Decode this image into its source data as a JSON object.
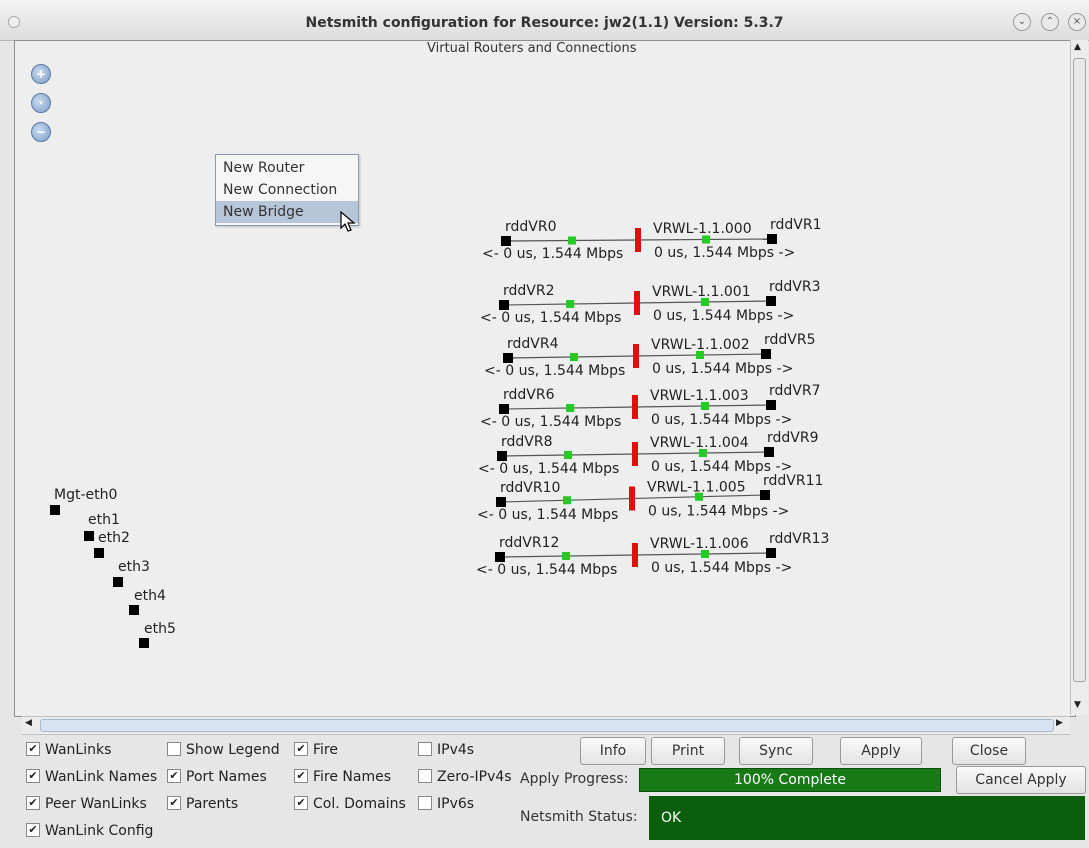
{
  "window": {
    "title": "Netsmith configuration for Resource:  jw2(1.1)  Version: 5.3.7"
  },
  "panel": {
    "legend": "Virtual Routers and Connections"
  },
  "context_menu": {
    "items": [
      "New Router",
      "New Connection",
      "New Bridge"
    ],
    "selected": "New Bridge"
  },
  "ports": {
    "mgt": "Mgt-eth0",
    "eth": [
      "eth1",
      "eth2",
      "eth3",
      "eth4",
      "eth5"
    ]
  },
  "wanlinks": [
    {
      "left": "rddVR0",
      "right": "rddVR1",
      "name": "VRWL-1.1.000",
      "left_stats": "<- 0 us, 1.544 Mbps",
      "right_stats": "0 us, 1.544 Mbps ->"
    },
    {
      "left": "rddVR2",
      "right": "rddVR3",
      "name": "VRWL-1.1.001",
      "left_stats": "<- 0 us, 1.544 Mbps",
      "right_stats": "0 us, 1.544 Mbps ->"
    },
    {
      "left": "rddVR4",
      "right": "rddVR5",
      "name": "VRWL-1.1.002",
      "left_stats": "<- 0 us, 1.544 Mbps",
      "right_stats": "0 us, 1.544 Mbps ->"
    },
    {
      "left": "rddVR6",
      "right": "rddVR7",
      "name": "VRWL-1.1.003",
      "left_stats": "<- 0 us, 1.544 Mbps",
      "right_stats": "0 us, 1.544 Mbps ->"
    },
    {
      "left": "rddVR8",
      "right": "rddVR9",
      "name": "VRWL-1.1.004",
      "left_stats": "<- 0 us, 1.544 Mbps",
      "right_stats": "0 us, 1.544 Mbps ->"
    },
    {
      "left": "rddVR10",
      "right": "rddVR11",
      "name": "VRWL-1.1.005",
      "left_stats": "<- 0 us, 1.544 Mbps",
      "right_stats": "0 us, 1.544 Mbps ->"
    },
    {
      "left": "rddVR12",
      "right": "rddVR13",
      "name": "VRWL-1.1.006",
      "left_stats": "<- 0 us, 1.544 Mbps",
      "right_stats": "0 us, 1.544 Mbps ->"
    }
  ],
  "options": {
    "wanlinks": {
      "label": "WanLinks",
      "checked": true
    },
    "wanlink_names": {
      "label": "WanLink Names",
      "checked": true
    },
    "peer_wanlinks": {
      "label": "Peer WanLinks",
      "checked": true
    },
    "wanlink_config": {
      "label": "WanLink Config",
      "checked": true
    },
    "show_legend": {
      "label": "Show Legend",
      "checked": false
    },
    "port_names": {
      "label": "Port Names",
      "checked": true
    },
    "parents": {
      "label": "Parents",
      "checked": true
    },
    "fire": {
      "label": "Fire",
      "checked": true
    },
    "fire_names": {
      "label": "Fire Names",
      "checked": true
    },
    "col_domains": {
      "label": "Col. Domains",
      "checked": true
    },
    "ipv4s": {
      "label": "IPv4s",
      "checked": false
    },
    "zero_ipv4s": {
      "label": "Zero-IPv4s",
      "checked": false
    },
    "ipv6s": {
      "label": "IPv6s",
      "checked": false
    }
  },
  "buttons": {
    "info": "Info",
    "print": "Print",
    "sync": "Sync",
    "apply": "Apply",
    "close": "Close",
    "cancel_apply": "Cancel Apply"
  },
  "apply_progress": {
    "label": "Apply Progress:",
    "text": "100% Complete",
    "value": 100
  },
  "netsmith_status": {
    "label": "Netsmith Status:",
    "text": "OK"
  },
  "colors": {
    "progress": "#177a17",
    "status": "#0b5e0b",
    "fire": "#e01010",
    "endpoint": "#22cc22",
    "selection": "#b7c5d8"
  }
}
